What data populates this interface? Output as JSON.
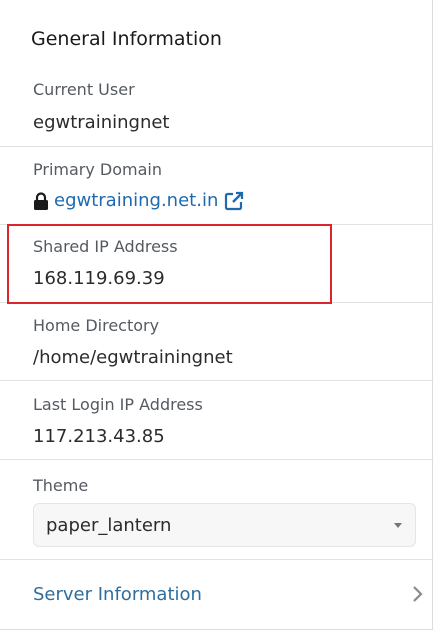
{
  "panel": {
    "title": "General Information"
  },
  "current_user": {
    "label": "Current User",
    "value": "egwtrainingnet"
  },
  "primary_domain": {
    "label": "Primary Domain",
    "value": "egwtraining.net.in",
    "lock_icon": "lock-icon",
    "external_icon": "external-link-icon"
  },
  "shared_ip": {
    "label": "Shared IP Address",
    "value": "168.119.69.39"
  },
  "home_directory": {
    "label": "Home Directory",
    "value": "/home/egwtrainingnet"
  },
  "last_login_ip": {
    "label": "Last Login IP Address",
    "value": "117.213.43.85"
  },
  "theme": {
    "label": "Theme",
    "selected": "paper_lantern"
  },
  "server_information": {
    "label": "Server Information",
    "icon": "chevron-right-icon"
  },
  "colors": {
    "link": "#1e6ab0",
    "highlight": "#d9262c",
    "label": "#555a61"
  }
}
